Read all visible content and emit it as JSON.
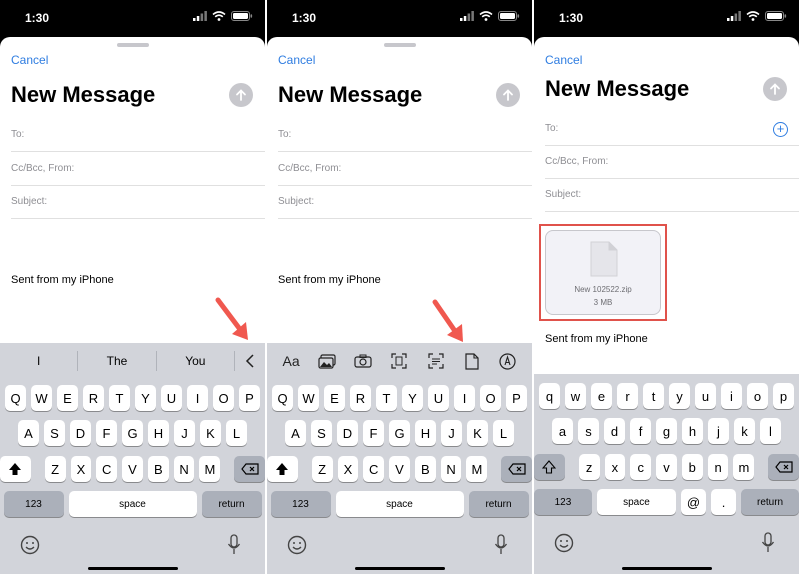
{
  "status": {
    "time": "1:30"
  },
  "compose": {
    "cancel": "Cancel",
    "title": "New Message",
    "to_label": "To:",
    "ccbcc_label": "Cc/Bcc, From:",
    "subject_label": "Subject:",
    "signature": "Sent from my iPhone"
  },
  "suggestions": [
    "I",
    "The",
    "You"
  ],
  "attachment": {
    "name": "New 102522.zip",
    "size": "3 MB"
  },
  "keyboard": {
    "row1": [
      "Q",
      "W",
      "E",
      "R",
      "T",
      "Y",
      "U",
      "I",
      "O",
      "P"
    ],
    "row2": [
      "A",
      "S",
      "D",
      "F",
      "G",
      "H",
      "J",
      "K",
      "L"
    ],
    "row3": [
      "Z",
      "X",
      "C",
      "V",
      "B",
      "N",
      "M"
    ],
    "numbers": "123",
    "space": "space",
    "return": "return",
    "row1_lower": [
      "q",
      "w",
      "e",
      "r",
      "t",
      "y",
      "u",
      "i",
      "o",
      "p"
    ],
    "row2_lower": [
      "a",
      "s",
      "d",
      "f",
      "g",
      "h",
      "j",
      "k",
      "l"
    ],
    "row3_lower": [
      "z",
      "x",
      "c",
      "v",
      "b",
      "n",
      "m"
    ],
    "at": "@",
    "dot": "."
  },
  "toolbar": {
    "font_format": "Aa"
  },
  "colors": {
    "accent": "#2f7de1",
    "highlight": "#e0524b",
    "arrow": "#f0584f"
  }
}
